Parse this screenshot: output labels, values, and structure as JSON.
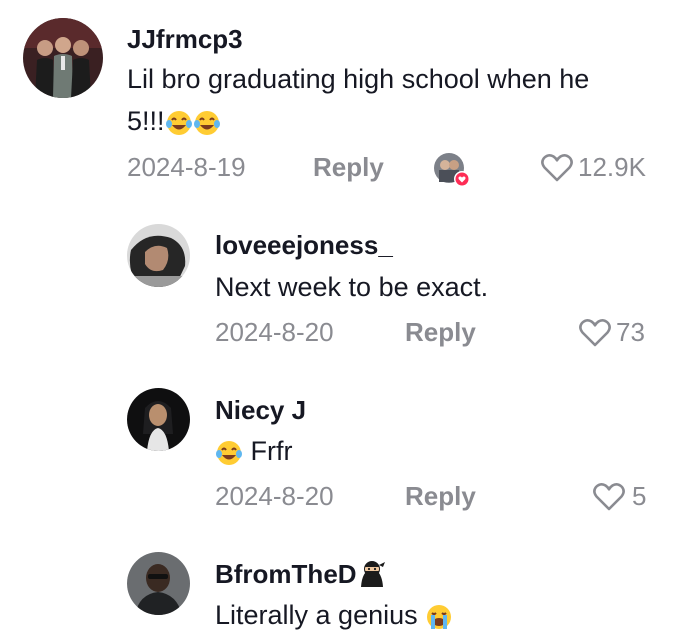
{
  "comments": [
    {
      "username": "JJfrmcp3",
      "text_line1": "Lil bro graduating high school when he",
      "text_line2": "5!!!",
      "date": "2024-8-19",
      "reply_label": "Reply",
      "likes": "12.9K"
    },
    {
      "username": "loveeejoness_",
      "text": "Next week to be exact.",
      "date": "2024-8-20",
      "reply_label": "Reply",
      "likes": "73"
    },
    {
      "username": "Niecy J",
      "text": "Frfr",
      "date": "2024-8-20",
      "reply_label": "Reply",
      "likes": "5"
    },
    {
      "username": "BfromTheD",
      "text": "Literally a genius"
    }
  ],
  "colors": {
    "primary_text": "#161823",
    "secondary_text": "#8a8b91",
    "liked_badge": "#fe2c55"
  },
  "icons": {
    "like": "heart-outline-icon",
    "laugh": "tears-of-joy-emoji",
    "cry": "loudly-crying-emoji",
    "ninja": "ninja-emoji",
    "creator_liked": "creator-liked-badge"
  }
}
